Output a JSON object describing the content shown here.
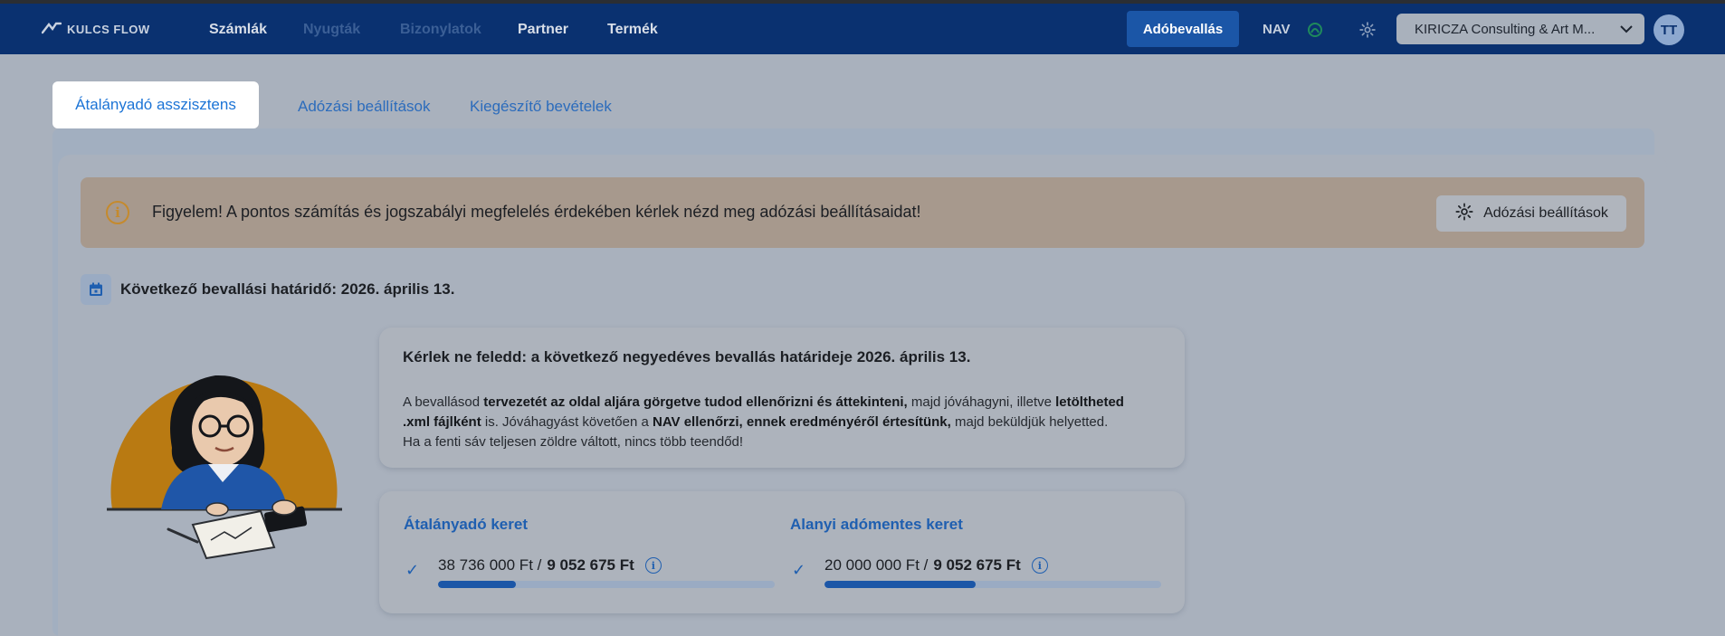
{
  "brand": {
    "name": "KULCS FLOW"
  },
  "nav": {
    "items": [
      {
        "label": "Számlák",
        "dim": false
      },
      {
        "label": "Nyugták",
        "dim": true
      },
      {
        "label": "Bizonylatok",
        "dim": true
      },
      {
        "label": "Partner",
        "dim": false
      },
      {
        "label": "Termék",
        "dim": false
      }
    ],
    "primary_button": "Adóbevallás",
    "nav_label": "NAV",
    "company": "KIRICZA Consulting & Art M...",
    "avatar": "TT"
  },
  "tabs": {
    "active": "Átalányadó asszisztens",
    "items": [
      "Adózási beállítások",
      "Kiegészítő bevételek"
    ]
  },
  "alert": {
    "text": "Figyelem! A pontos számítás és jogszabályi megfelelés érdekében kérlek nézd meg adózási beállításaidat!",
    "button": "Adózási beállítások"
  },
  "deadline": {
    "text": "Következő bevallási határidő: 2026. április 13."
  },
  "reminder": {
    "title": "Kérlek ne feledd: a következő negyedéves bevallás határideje 2026. április 13.",
    "p1": "A bevallásod ",
    "b1": "tervezetét az oldal aljára görgetve tudod ellenőrizni és áttekinteni,",
    "p2": " majd jóváhagyni, illetve ",
    "b2": "letöltheted .xml fájlként",
    "p3": " is. Jóváhagyást követően a ",
    "b3": "NAV ellenőrzi, ennek eredményéről értesítünk,",
    "p4": " majd beküldjük helyetted. Ha a fenti sáv teljesen zöldre váltott, nincs több teendőd!"
  },
  "limits": [
    {
      "title": "Átalányadó keret",
      "used": "38 736 000 Ft / ",
      "total": "9 052 675 Ft",
      "progress": 0.23
    },
    {
      "title": "Alanyi adómentes keret",
      "used": "20 000 000 Ft / ",
      "total": "9 052 675 Ft",
      "progress": 0.45
    }
  ],
  "colors": {
    "accent": "#1b56a7",
    "nav_bg": "#0a3170",
    "alert_icon": "#c58a2d"
  }
}
